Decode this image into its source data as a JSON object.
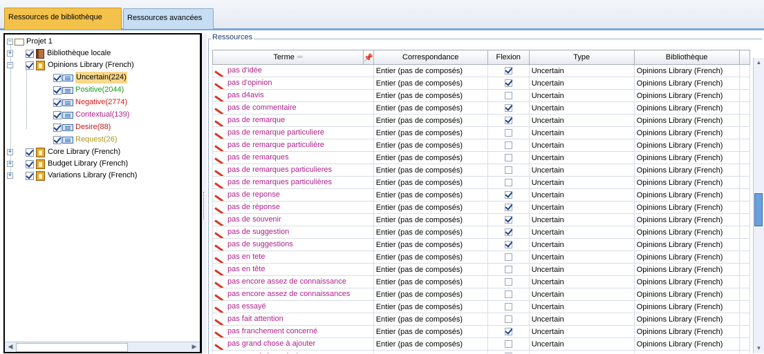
{
  "tabs": [
    {
      "label": "Ressources de bibliothèque",
      "active": true
    },
    {
      "label": "Ressources avancées",
      "active": false
    }
  ],
  "tree": {
    "root": "Projet 1",
    "local": "Bibliothèque locale",
    "opinions": "Opinions Library (French)",
    "categories": [
      {
        "label": "Uncertain(224)",
        "color": "#000000",
        "selected": true
      },
      {
        "label": "Positive(2044)",
        "color": "#1aa01a"
      },
      {
        "label": "Negative(2774)",
        "color": "#d81818"
      },
      {
        "label": "Contextual(139)",
        "color": "#b0208c"
      },
      {
        "label": "Desire(88)",
        "color": "#c01818"
      },
      {
        "label": "Request(26)",
        "color": "#a89a18"
      }
    ],
    "other_libraries": [
      "Core Library (French)",
      "Budget Library (French)",
      "Variations Library (French)"
    ]
  },
  "resources": {
    "group_label": "Ressources",
    "columns": {
      "term": "Terme",
      "match": "Correspondance",
      "inflect": "Flexion",
      "type": "Type",
      "library": "Bibliothèque"
    },
    "rows": [
      {
        "term": "pas d'idée",
        "match": "Entier (pas de composés)",
        "inflect": true,
        "type": "Uncertain",
        "library": "Opinions Library (French)"
      },
      {
        "term": "pas d'opinion",
        "match": "Entier (pas de composés)",
        "inflect": true,
        "type": "Uncertain",
        "library": "Opinions Library (French)"
      },
      {
        "term": "pas d4avis",
        "match": "Entier (pas de composés)",
        "inflect": false,
        "type": "Uncertain",
        "library": "Opinions Library (French)"
      },
      {
        "term": "pas de commentaire",
        "match": "Entier (pas de composés)",
        "inflect": true,
        "type": "Uncertain",
        "library": "Opinions Library (French)"
      },
      {
        "term": "pas de remarque",
        "match": "Entier (pas de composés)",
        "inflect": true,
        "type": "Uncertain",
        "library": "Opinions Library (French)"
      },
      {
        "term": "pas de remarque particuliere",
        "match": "Entier (pas de composés)",
        "inflect": false,
        "type": "Uncertain",
        "library": "Opinions Library (French)"
      },
      {
        "term": "pas de remarque particulière",
        "match": "Entier (pas de composés)",
        "inflect": false,
        "type": "Uncertain",
        "library": "Opinions Library (French)"
      },
      {
        "term": "pas de remarques",
        "match": "Entier (pas de composés)",
        "inflect": false,
        "type": "Uncertain",
        "library": "Opinions Library (French)"
      },
      {
        "term": "pas de remarques particulieres",
        "match": "Entier (pas de composés)",
        "inflect": false,
        "type": "Uncertain",
        "library": "Opinions Library (French)"
      },
      {
        "term": "pas de remarques particulières",
        "match": "Entier (pas de composés)",
        "inflect": false,
        "type": "Uncertain",
        "library": "Opinions Library (French)"
      },
      {
        "term": "pas de reponse",
        "match": "Entier (pas de composés)",
        "inflect": true,
        "type": "Uncertain",
        "library": "Opinions Library (French)"
      },
      {
        "term": "pas de réponse",
        "match": "Entier (pas de composés)",
        "inflect": true,
        "type": "Uncertain",
        "library": "Opinions Library (French)"
      },
      {
        "term": "pas de souvenir",
        "match": "Entier (pas de composés)",
        "inflect": true,
        "type": "Uncertain",
        "library": "Opinions Library (French)"
      },
      {
        "term": "pas de suggestion",
        "match": "Entier (pas de composés)",
        "inflect": true,
        "type": "Uncertain",
        "library": "Opinions Library (French)"
      },
      {
        "term": "pas de suggestions",
        "match": "Entier (pas de composés)",
        "inflect": true,
        "type": "Uncertain",
        "library": "Opinions Library (French)"
      },
      {
        "term": "pas en tete",
        "match": "Entier (pas de composés)",
        "inflect": false,
        "type": "Uncertain",
        "library": "Opinions Library (French)"
      },
      {
        "term": "pas en tête",
        "match": "Entier (pas de composés)",
        "inflect": false,
        "type": "Uncertain",
        "library": "Opinions Library (French)"
      },
      {
        "term": "pas encore assez de connaissance",
        "match": "Entier (pas de composés)",
        "inflect": false,
        "type": "Uncertain",
        "library": "Opinions Library (French)"
      },
      {
        "term": "pas encore assez de connaissances",
        "match": "Entier (pas de composés)",
        "inflect": false,
        "type": "Uncertain",
        "library": "Opinions Library (French)"
      },
      {
        "term": "pas essayé",
        "match": "Entier (pas de composés)",
        "inflect": false,
        "type": "Uncertain",
        "library": "Opinions Library (French)"
      },
      {
        "term": "pas fait attention",
        "match": "Entier (pas de composés)",
        "inflect": false,
        "type": "Uncertain",
        "library": "Opinions Library (French)"
      },
      {
        "term": "pas franchement concerné",
        "match": "Entier (pas de composés)",
        "inflect": true,
        "type": "Uncertain",
        "library": "Opinions Library (French)"
      },
      {
        "term": "pas grand chose à ajouter",
        "match": "Entier (pas de composés)",
        "inflect": false,
        "type": "Uncertain",
        "library": "Opinions Library (French)"
      },
      {
        "term": "pas grand chose à ajouter",
        "match": "Entier (pas de composés)",
        "inflect": false,
        "type": "Uncertain",
        "library": "Opinions Library (French)"
      }
    ]
  }
}
